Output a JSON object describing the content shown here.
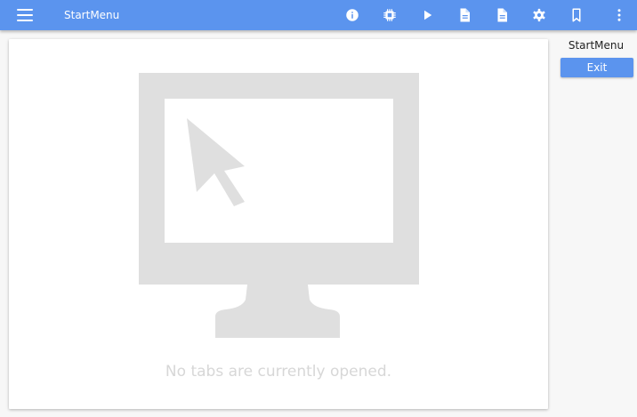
{
  "header": {
    "title": "StartMenu",
    "icons": [
      "menu-icon",
      "info-icon",
      "chip-icon",
      "play-icon",
      "document-icon",
      "document-icon",
      "gear-icon",
      "bookmark-icon",
      "more-vert-icon"
    ]
  },
  "main": {
    "empty_message": "No tabs are currently opened."
  },
  "sidebar": {
    "title": "StartMenu",
    "exit_label": "Exit"
  },
  "colors": {
    "accent": "#5b94ee",
    "placeholder_gray": "#dfdfdf"
  }
}
